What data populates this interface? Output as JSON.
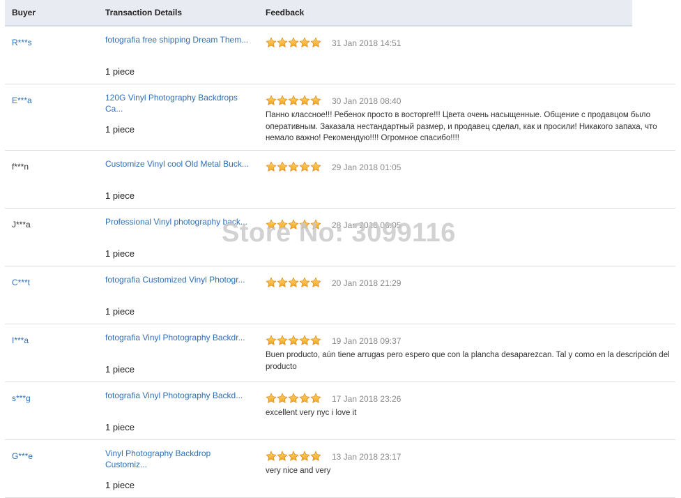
{
  "header": {
    "buyer": "Buyer",
    "details": "Transaction Details",
    "feedback": "Feedback"
  },
  "watermark": "Store No: 3099116",
  "rating_icon": "star-icon",
  "star_color": "#f5a623",
  "reviews": [
    {
      "buyer": "R***s",
      "product": "fotografia free shipping Dream Them...",
      "qty": "1 piece",
      "rating": 5,
      "date": "31 Jan 2018 14:51",
      "comment": ""
    },
    {
      "buyer": "E***a",
      "product": "120G Vinyl Photography Backdrops Ca...",
      "qty": "1 piece",
      "rating": 5,
      "date": "30 Jan 2018 08:40",
      "comment": "Панно классное!!! Ребенок просто в восторге!!! Цвета очень насыщенные. Общение с продавцом было оперативным. Заказала нестандартный размер, и продавец сделал, как и просили! Никакого запаха, что немало важно! Рекомендую!!!! Огромное спасибо!!!!"
    },
    {
      "buyer": "f***n",
      "product": "Customize Vinyl cool Old Metal Buck...",
      "qty": "1 piece",
      "rating": 5,
      "date": "29 Jan 2018 01:05",
      "comment": ""
    },
    {
      "buyer": "J***a",
      "product": "Professional Vinyl photography back...",
      "qty": "1 piece",
      "rating": 5,
      "date": "28 Jan 2018 06:05",
      "comment": ""
    },
    {
      "buyer": "C***t",
      "product": "fotografia Customized Vinyl Photogr...",
      "qty": "1 piece",
      "rating": 5,
      "date": "20 Jan 2018 21:29",
      "comment": ""
    },
    {
      "buyer": "I***a",
      "product": "fotografia Vinyl Photography Backdr...",
      "qty": "1 piece",
      "rating": 5,
      "date": "19 Jan 2018 09:37",
      "comment": "Buen producto, aún tiene arrugas pero espero que con la plancha desaparezcan. Tal y como en la descripción del producto"
    },
    {
      "buyer": "s***g",
      "product": "fotografia Vinyl Photography Backd...",
      "qty": "1 piece",
      "rating": 5,
      "date": "17 Jan 2018 23:26",
      "comment": "excellent very nyc i love it"
    },
    {
      "buyer": "G***e",
      "product": "Vinyl Photography Backdrop Customiz...",
      "qty": "1 piece",
      "rating": 5,
      "date": "13 Jan 2018 23:17",
      "comment": "very nice and very"
    }
  ]
}
